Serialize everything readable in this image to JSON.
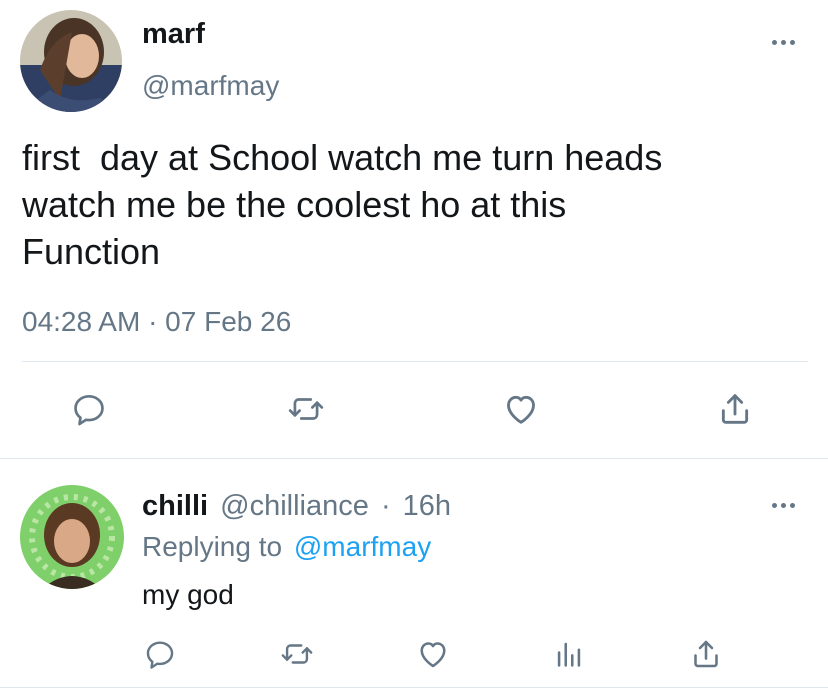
{
  "main_tweet": {
    "display_name": "marf",
    "handle": "@marfmay",
    "text_lines": [
      "first  day at School watch me turn heads",
      "watch me be the coolest ho at this",
      "Function"
    ],
    "timestamp": "04:28 AM · 07 Feb 26",
    "actions": [
      "reply-icon",
      "retweet-icon",
      "like-icon",
      "share-icon"
    ]
  },
  "reply": {
    "display_name": "chilli",
    "handle": "@chilliance",
    "separator": "·",
    "time": "16h",
    "replying_to_label": "Replying to",
    "replying_to_handle": "@marfmay",
    "text": "my god",
    "actions": [
      "reply-icon",
      "retweet-icon",
      "like-icon",
      "analytics-icon",
      "share-icon"
    ]
  },
  "colors": {
    "text": "#14171a",
    "secondary": "#657786",
    "link": "#1da1f2",
    "divider": "#e1e8ed"
  }
}
